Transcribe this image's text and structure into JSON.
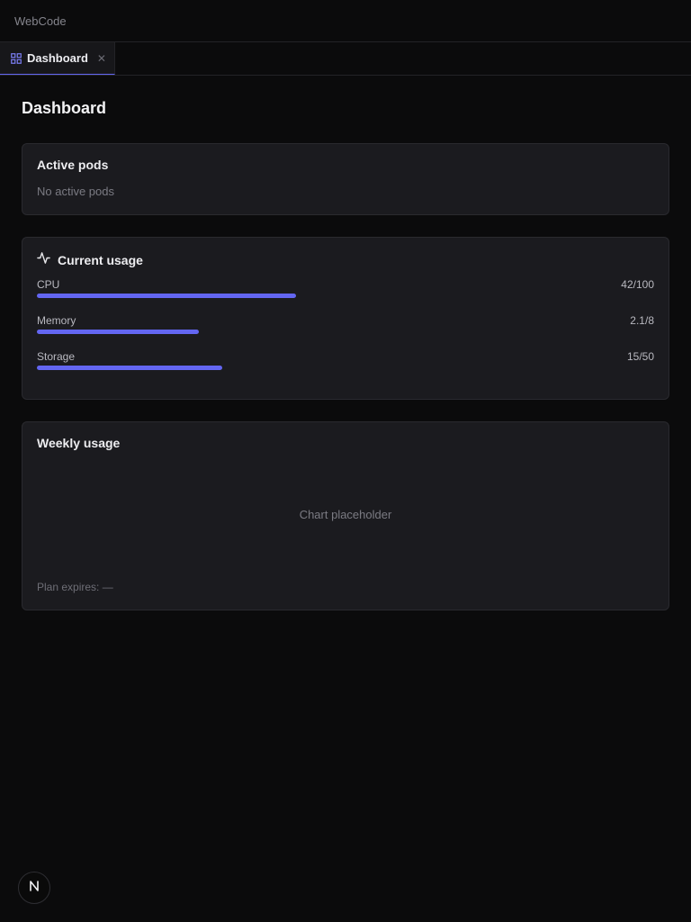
{
  "app": {
    "title": "WebCode"
  },
  "tabs": [
    {
      "label": "Dashboard",
      "icon": "dashboard-grid-icon",
      "close_icon": "close-icon"
    }
  ],
  "page": {
    "title": "Dashboard"
  },
  "active_pods": {
    "title": "Active pods",
    "empty_text": "No active pods"
  },
  "current_usage": {
    "title": "Current usage",
    "icon": "activity-pulse-icon",
    "accent_color": "#6366f1",
    "metrics": [
      {
        "label": "CPU",
        "value_text": "42/100",
        "used": 42,
        "total": 100
      },
      {
        "label": "Memory",
        "value_text": "2.1/8",
        "used": 2.1,
        "total": 8
      },
      {
        "label": "Storage",
        "value_text": "15/50",
        "used": 15,
        "total": 50
      }
    ]
  },
  "weekly_usage": {
    "title": "Weekly usage",
    "chart_placeholder": "Chart placeholder",
    "plan_expires": "Plan expires: —"
  },
  "floating_badge": {
    "icon": "n-logo-icon",
    "label": "N"
  }
}
